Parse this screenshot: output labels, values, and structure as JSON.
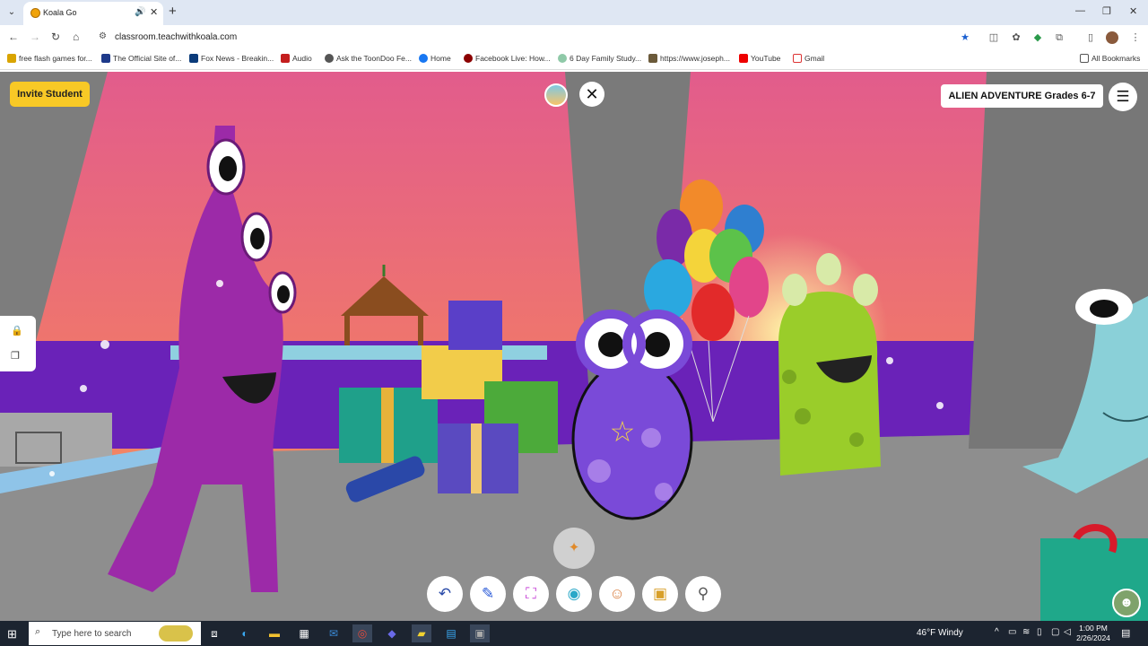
{
  "browser": {
    "tab_title": "Koala Go",
    "url": "classroom.teachwithkoala.com",
    "bookmarks": [
      "free flash games for...",
      "The Official Site of...",
      "Fox News - Breakin...",
      "Audio",
      "Ask the ToonDoo Fe...",
      "Home",
      "Facebook Live: How...",
      "6 Day Family Study...",
      "https://www.joseph...",
      "YouTube",
      "Gmail"
    ],
    "all_bookmarks": "All Bookmarks"
  },
  "game": {
    "invite_label": "Invite Student",
    "lesson_title": "ALIEN ADVENTURE Grades 6-7"
  },
  "taskbar": {
    "search_placeholder": "Type here to search",
    "weather": "46°F  Windy",
    "time": "1:00 PM",
    "date": "2/26/2024"
  },
  "colors": {
    "accent_yellow": "#f8c926",
    "sky_top": "#e25c8c",
    "sky_bottom": "#f7a05a",
    "floor": "#8e8e8e"
  }
}
